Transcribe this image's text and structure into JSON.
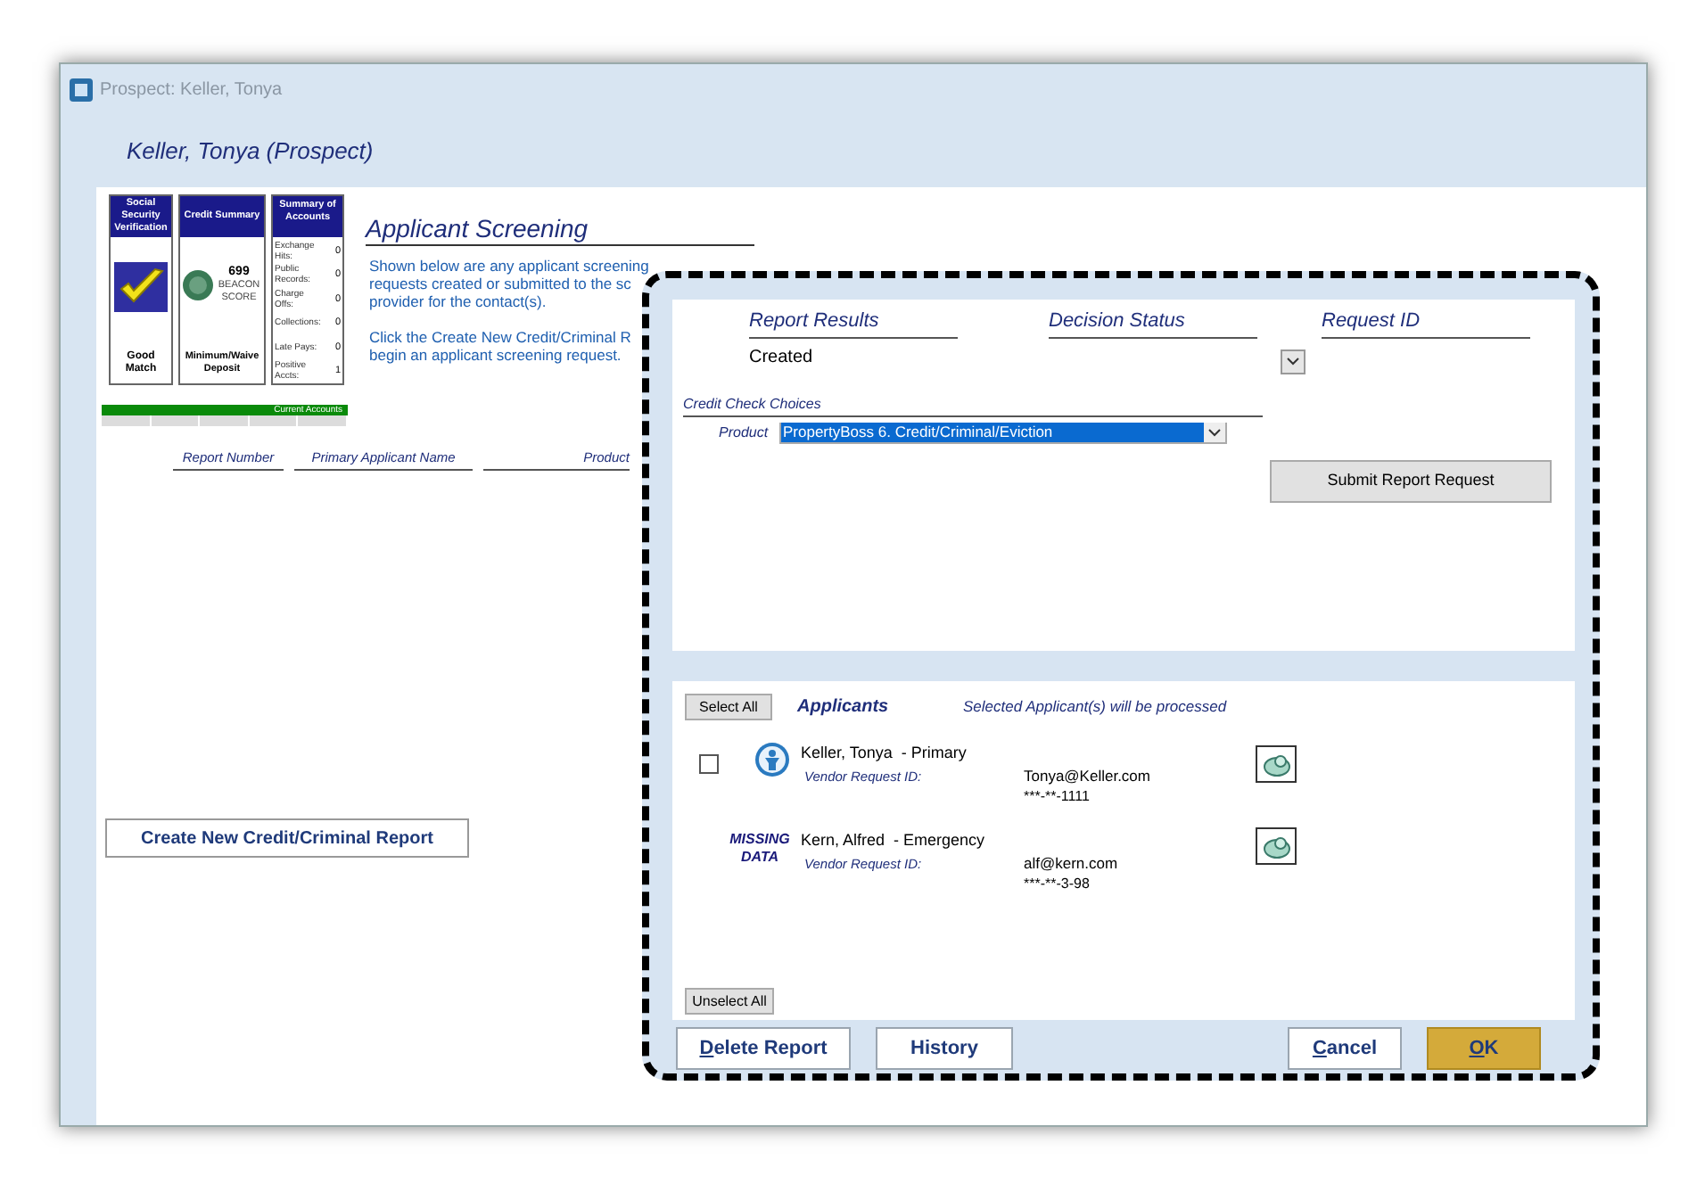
{
  "window": {
    "title": "Prospect: Keller, Tonya"
  },
  "header": "Keller, Tonya (Prospect)",
  "ssn_card": {
    "title": "Social Security Verification",
    "result": "Good Match"
  },
  "credit_card": {
    "title": "Credit Summary",
    "score": "699",
    "score_label": "BEACON SCORE",
    "result": "Minimum/Waive Deposit"
  },
  "accounts_card": {
    "title": "Summary of Accounts",
    "items": [
      {
        "label": "Exchange Hits:",
        "value": "0"
      },
      {
        "label": "Public Records:",
        "value": "0"
      },
      {
        "label": "Charge Offs:",
        "value": "0"
      },
      {
        "label": "Collections:",
        "value": "0"
      },
      {
        "label": "Late Pays:",
        "value": "0"
      },
      {
        "label": "Positive Accts:",
        "value": "1"
      }
    ]
  },
  "current_accounts": {
    "label": "Current Accounts"
  },
  "screening": {
    "title": "Applicant Screening",
    "paragraphs": [
      "Shown below are any applicant screening requests created or submitted to the sc provider for the contact(s).",
      "Click the Create New Credit/Criminal R begin an applicant screening request."
    ]
  },
  "report_columns": [
    "Report Number",
    "Primary Applicant Name",
    "Product"
  ],
  "create_button": "Create New Credit/Criminal Report",
  "dialog": {
    "columns": [
      "Report Results",
      "Decision Status",
      "Request ID"
    ],
    "report_result": "Created",
    "choices_title": "Credit Check Choices",
    "product_label": "Product",
    "product_value": "PropertyBoss 6. Credit/Criminal/Eviction",
    "submit_button": "Submit Report Request",
    "select_all": "Select All",
    "applicants_title": "Applicants",
    "applicants_note": "Selected Applicant(s) will be processed",
    "applicants": [
      {
        "kind": "checkbox",
        "checked": false,
        "name": "Keller, Tonya  - Primary",
        "vendor_label": "Vendor Request ID:",
        "email": "Tonya@Keller.com",
        "ssn": "***-**-1111"
      },
      {
        "kind": "missing",
        "badge": "MISSING DATA",
        "name": "Kern, Alfred  - Emergency",
        "vendor_label": "Vendor Request ID:",
        "email": "alf@kern.com",
        "ssn": "***-**-3-98"
      }
    ],
    "unselect_all": "Unselect All",
    "buttons": [
      {
        "kind": "plain",
        "accel": "D",
        "label": "elete Report"
      },
      {
        "kind": "plain",
        "label": "History"
      },
      {
        "kind": "plain",
        "accel": "C",
        "label": "ancel"
      },
      {
        "kind": "primary",
        "accel": "O",
        "label": "K"
      }
    ]
  }
}
